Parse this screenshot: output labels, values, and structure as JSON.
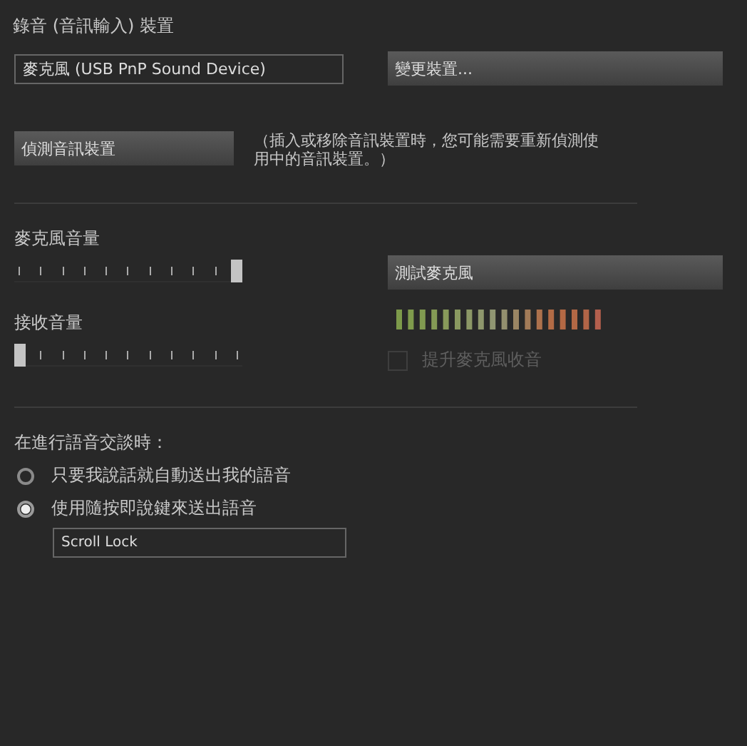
{
  "recording_device": {
    "title": "錄音 (音訊輸入) 裝置",
    "device_value": "麥克風 (USB PnP Sound Device)",
    "change_button": "變更裝置...",
    "detect_button": "偵測音訊裝置",
    "detect_note": "（插入或移除音訊裝置時，您可能需要重新偵測使用中的音訊裝置。）"
  },
  "mic_volume": {
    "label": "麥克風音量",
    "level": 1
  },
  "test_button": "測試麥克風",
  "receive_volume": {
    "label": "接收音量",
    "level": 0
  },
  "boost": {
    "label": "提升麥克風收音",
    "checked": false,
    "disabled": true
  },
  "voice": {
    "title": "在進行語音交談時：",
    "options": [
      {
        "label": "只要我說話就自動送出我的語音",
        "selected": false
      },
      {
        "label": "使用隨按即說鍵來送出語音",
        "selected": true
      }
    ],
    "key_value": "Scroll Lock"
  }
}
